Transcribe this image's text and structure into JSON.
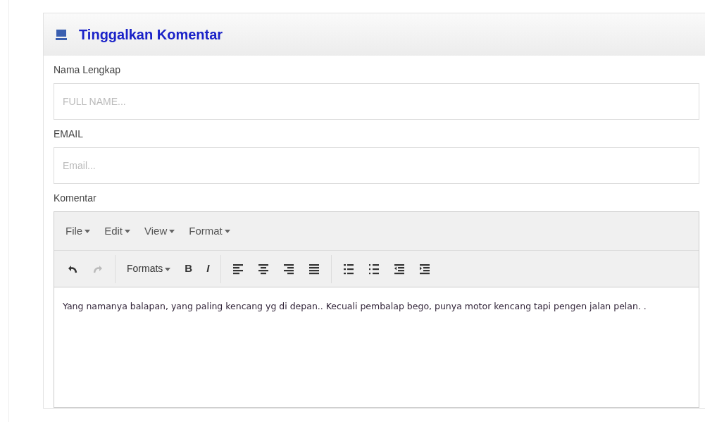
{
  "panel": {
    "title": "Tinggalkan Komentar"
  },
  "fields": [
    {
      "label": "Nama Lengkap",
      "placeholder": "FULL NAME..."
    },
    {
      "label": "EMAIL",
      "placeholder": "Email..."
    }
  ],
  "editor": {
    "label": "Komentar",
    "menus": [
      "File",
      "Edit",
      "View",
      "Format"
    ],
    "toolbar": [
      {
        "kind": "undo",
        "disabled": false
      },
      {
        "kind": "redo",
        "disabled": true
      },
      {
        "kind": "dropdown",
        "label": "Formats",
        "disabled": false
      },
      {
        "kind": "bold",
        "label": "B",
        "disabled": false
      },
      {
        "kind": "italic",
        "label": "I",
        "disabled": false
      },
      {
        "kind": "alignleft",
        "disabled": false
      },
      {
        "kind": "aligncenter",
        "disabled": false
      },
      {
        "kind": "alignright",
        "disabled": false
      },
      {
        "kind": "justify",
        "disabled": false
      },
      {
        "kind": "bullets",
        "disabled": false
      },
      {
        "kind": "numbers",
        "disabled": false
      },
      {
        "kind": "outdent",
        "disabled": false
      },
      {
        "kind": "indent",
        "disabled": false
      }
    ],
    "content": "Yang namanya balapan, yang paling kencang yg di depan.. Kecuali pembalap bego, punya motor kencang tapi pengen jalan pelan. ."
  }
}
